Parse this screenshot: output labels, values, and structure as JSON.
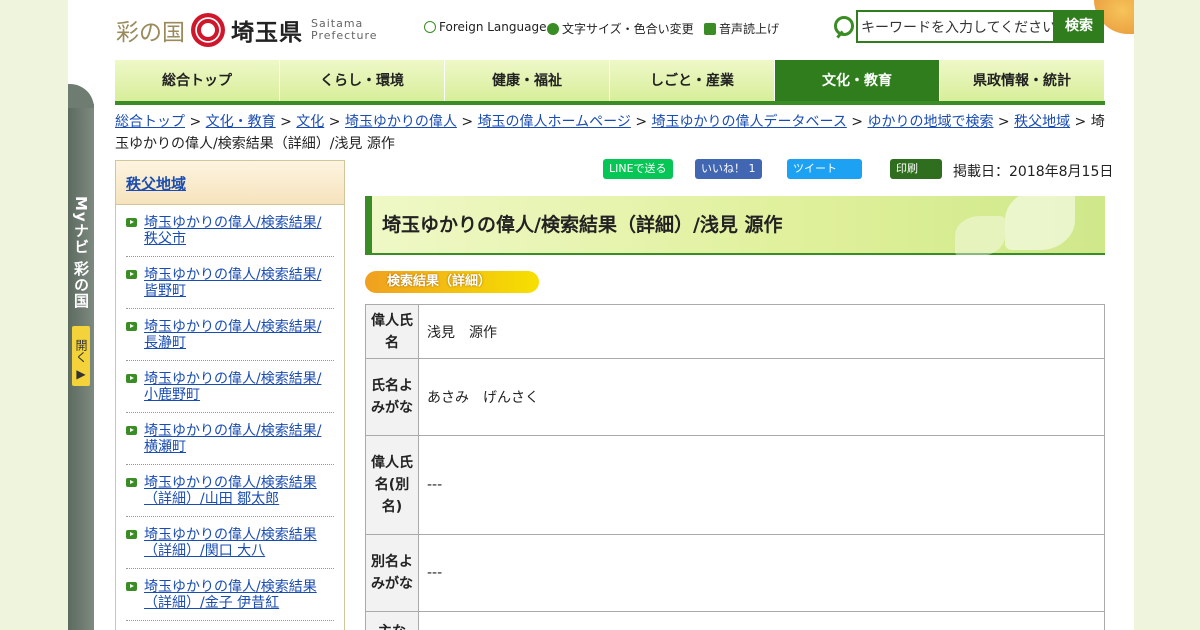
{
  "header": {
    "logo_ja1": "彩の国",
    "logo_ja2": "埼玉県",
    "logo_en1": "Saitama",
    "logo_en2": "Prefecture",
    "foreign_language": "Foreign Language",
    "text_size": "文字サイズ・色合い変更",
    "voice": "音声読上げ",
    "search_placeholder": "キーワードを入力してください",
    "search_button": "検索"
  },
  "gnav": {
    "items": [
      "総合トップ",
      "くらし・環境",
      "健康・福祉",
      "しごと・産業",
      "文化・教育",
      "県政情報・統計"
    ],
    "active_index": 4
  },
  "breadcrumb": {
    "links": [
      "総合トップ",
      "文化・教育",
      "文化",
      "埼玉ゆかりの偉人",
      "埼玉の偉人ホームページ",
      "埼玉ゆかりの偉人データベース",
      "ゆかりの地域で検索",
      "秩父地域"
    ],
    "current": "埼玉ゆかりの偉人/検索結果（詳細）/浅見 源作"
  },
  "mynavi": {
    "label": "Myナビ 彩の国",
    "open": "開く ▶"
  },
  "sidebar": {
    "heading": "秩父地域",
    "items": [
      "埼玉ゆかりの偉人/検索結果/秩父市",
      "埼玉ゆかりの偉人/検索結果/皆野町",
      "埼玉ゆかりの偉人/検索結果/長瀞町",
      "埼玉ゆかりの偉人/検索結果/小鹿野町",
      "埼玉ゆかりの偉人/検索結果/横瀬町",
      "埼玉ゆかりの偉人/検索結果（詳細）/山田 鄒太郎",
      "埼玉ゆかりの偉人/検索結果（詳細）/関口 大八",
      "埼玉ゆかりの偉人/検索結果（詳細）/金子 伊昔紅"
    ]
  },
  "share": {
    "line": "LINEで送る",
    "like": "いいね！ 1",
    "tweet": "ツイート",
    "print": "印刷",
    "published": "掲載日：2018年8月15日"
  },
  "page_title": "埼玉ゆかりの偉人/検索結果（詳細）/浅見 源作",
  "section_badge": "検索結果（詳細）",
  "table": {
    "rows": [
      {
        "label": "偉人氏名",
        "value": "浅見　源作"
      },
      {
        "label": "氏名よみがな",
        "value": "あさみ　げんさく"
      },
      {
        "label": "偉人氏名(別名)",
        "value": "---"
      },
      {
        "label": "別名よみがな",
        "value": "---"
      },
      {
        "label": "主な",
        "value": ""
      }
    ]
  },
  "colors": {
    "accent": "#3a8d24",
    "link": "#1a4db3"
  }
}
